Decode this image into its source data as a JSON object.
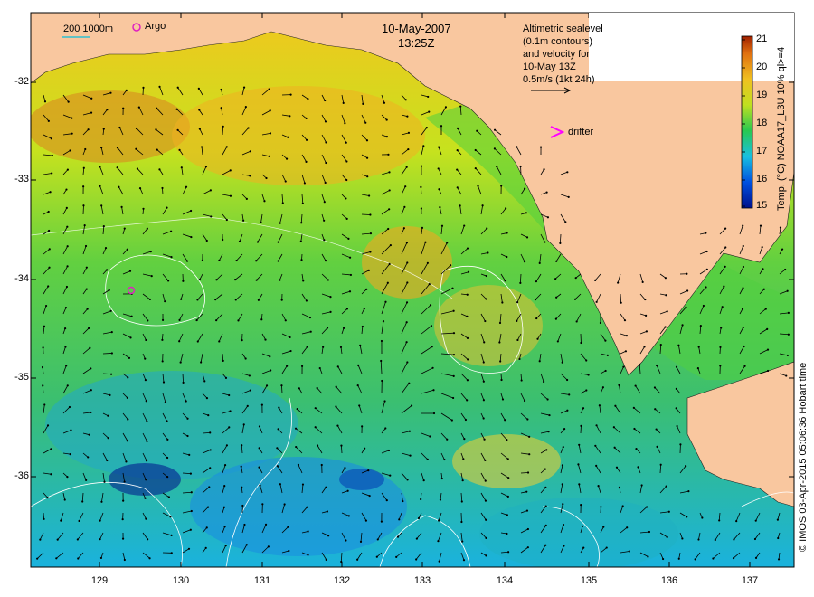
{
  "header": {
    "date": "10-May-2007",
    "time": "13:25Z"
  },
  "top_left_legend": {
    "scale_label": "200  1000m",
    "argo_label": "Argo"
  },
  "info_box": {
    "line1": "Altimetric sealevel",
    "line2": "(0.1m contours)",
    "line3": "and velocity for",
    "line4": "10-May 13Z",
    "line5": "0.5m/s (1kt 24h)"
  },
  "drifter_label": "drifter",
  "colorbar": {
    "title": "Temp. (°C) NOAA17_L3U 10% ql>=4",
    "ticks": [
      "15",
      "16",
      "17",
      "18",
      "19",
      "20",
      "21"
    ]
  },
  "axes": {
    "y_ticks": [
      "-32",
      "-33",
      "-34",
      "-35",
      "-36"
    ],
    "x_ticks": [
      "129",
      "130",
      "131",
      "132",
      "133",
      "134",
      "135",
      "136",
      "137"
    ]
  },
  "credit": "© IMOS 03-Apr-2015 05:06:36 Hobart time",
  "colors": {
    "land": "#f9c79f",
    "cold": "#00108a",
    "warm": "#d46000",
    "drifter": "#ff00ff",
    "argo": "#e020c0"
  }
}
